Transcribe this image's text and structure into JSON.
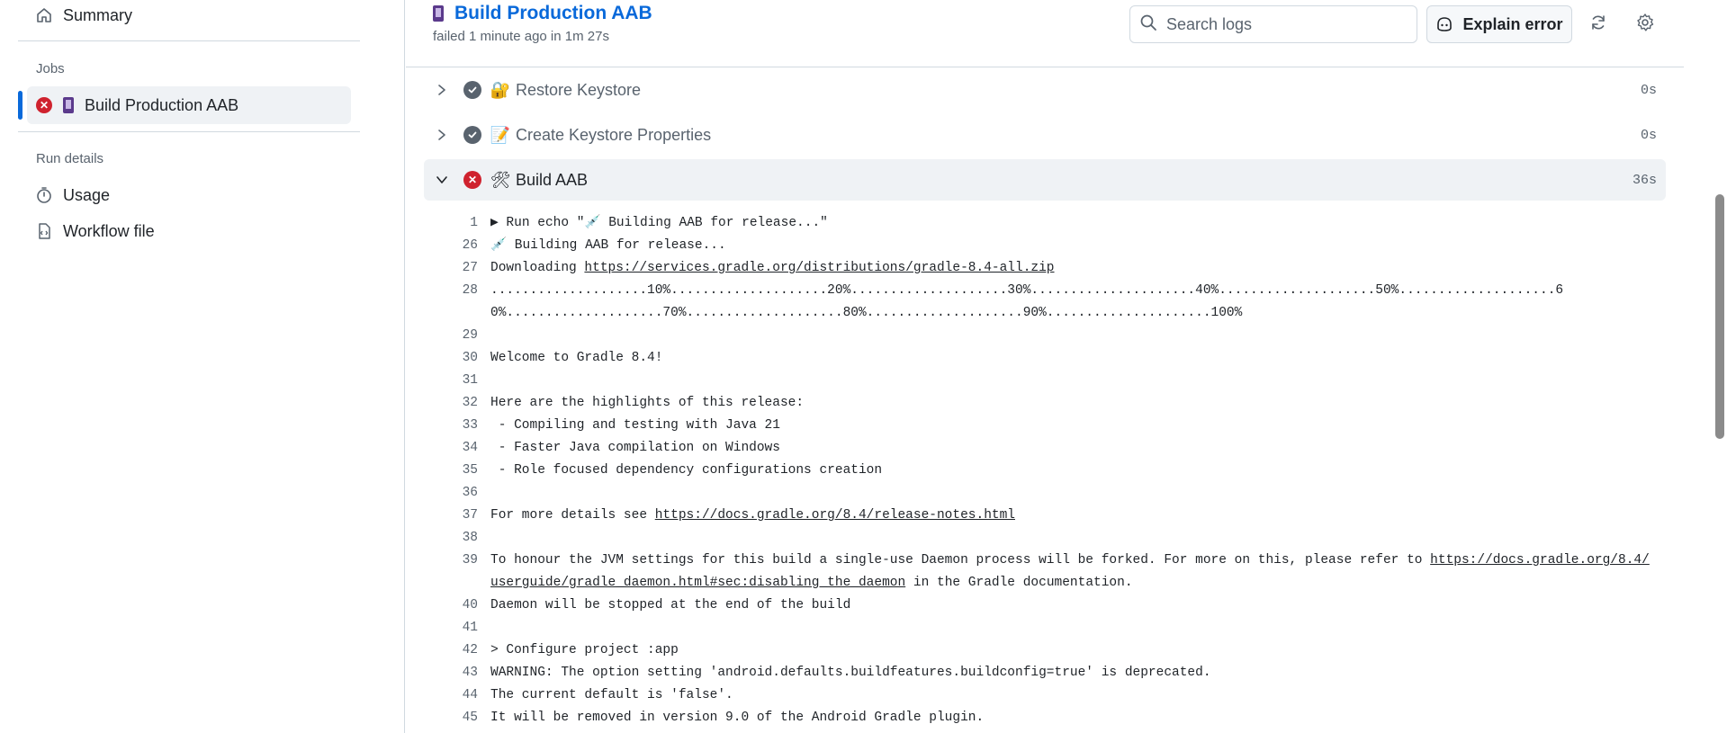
{
  "sidebar": {
    "summary": "Summary",
    "jobs_heading": "Jobs",
    "job_name": "Build Production AAB",
    "run_details_heading": "Run details",
    "usage": "Usage",
    "workflow_file": "Workflow file"
  },
  "header": {
    "title": "Build Production AAB",
    "subtitle": "failed 1 minute ago in 1m 27s",
    "search_placeholder": "Search logs",
    "explain_button": "Explain error"
  },
  "steps": [
    {
      "name": "Restore Keystore",
      "emoji": "🔐",
      "status": "success",
      "time": "0s"
    },
    {
      "name": "Create Keystore Properties",
      "emoji": "📝",
      "status": "success",
      "time": "0s"
    },
    {
      "name": "Build AAB",
      "emoji": "🛠",
      "status": "failure",
      "time": "36s"
    }
  ],
  "log": {
    "l1_num": "1",
    "l1_text": "▶ Run echo \"💉 Building AAB for release...\"",
    "l26_num": "26",
    "l26_text": "💉 Building AAB for release...",
    "l27_num": "27",
    "l27_prefix": "Downloading ",
    "l27_link": "https://services.gradle.org/distributions/gradle-8.4-all.zip",
    "l28_num": "28",
    "l28_text": "....................10%....................20%....................30%.....................40%....................50%....................60%....................70%....................80%....................90%.....................100%",
    "l29_num": "29",
    "l30_num": "30",
    "l30_text": "Welcome to Gradle 8.4!",
    "l31_num": "31",
    "l32_num": "32",
    "l32_text": "Here are the highlights of this release:",
    "l33_num": "33",
    "l33_text": " - Compiling and testing with Java 21",
    "l34_num": "34",
    "l34_text": " - Faster Java compilation on Windows",
    "l35_num": "35",
    "l35_text": " - Role focused dependency configurations creation",
    "l36_num": "36",
    "l37_num": "37",
    "l37_prefix": "For more details see ",
    "l37_link": "https://docs.gradle.org/8.4/release-notes.html",
    "l38_num": "38",
    "l39_num": "39",
    "l39_text": "To honour the JVM settings for this build a single-use Daemon process will be forked. For more on this, please refer to ",
    "l39_link": "https://docs.gradle.org/8.4/userguide/gradle_daemon.html#sec:disabling_the_daemon",
    "l39_suffix": " in the Gradle documentation.",
    "l40_num": "40",
    "l40_text": "Daemon will be stopped at the end of the build",
    "l41_num": "41",
    "l42_num": "42",
    "l42_text": "> Configure project :app",
    "l43_num": "43",
    "l43_text": "WARNING: The option setting 'android.defaults.buildfeatures.buildconfig=true' is deprecated.",
    "l44_num": "44",
    "l44_text": "The current default is 'false'.",
    "l45_num": "45",
    "l45_text": "It will be removed in version 9.0 of the Android Gradle plugin."
  },
  "colors": {
    "accent": "#0969da",
    "failure": "#cf222e",
    "muted": "#59636e"
  },
  "icons": [
    "home-icon",
    "phone-icon",
    "stopwatch-icon",
    "workflow-file-icon",
    "search-icon",
    "copilot-icon",
    "refresh-icon",
    "gear-icon",
    "chevron-right-icon",
    "chevron-down-icon",
    "check-circle-icon",
    "x-circle-icon"
  ]
}
